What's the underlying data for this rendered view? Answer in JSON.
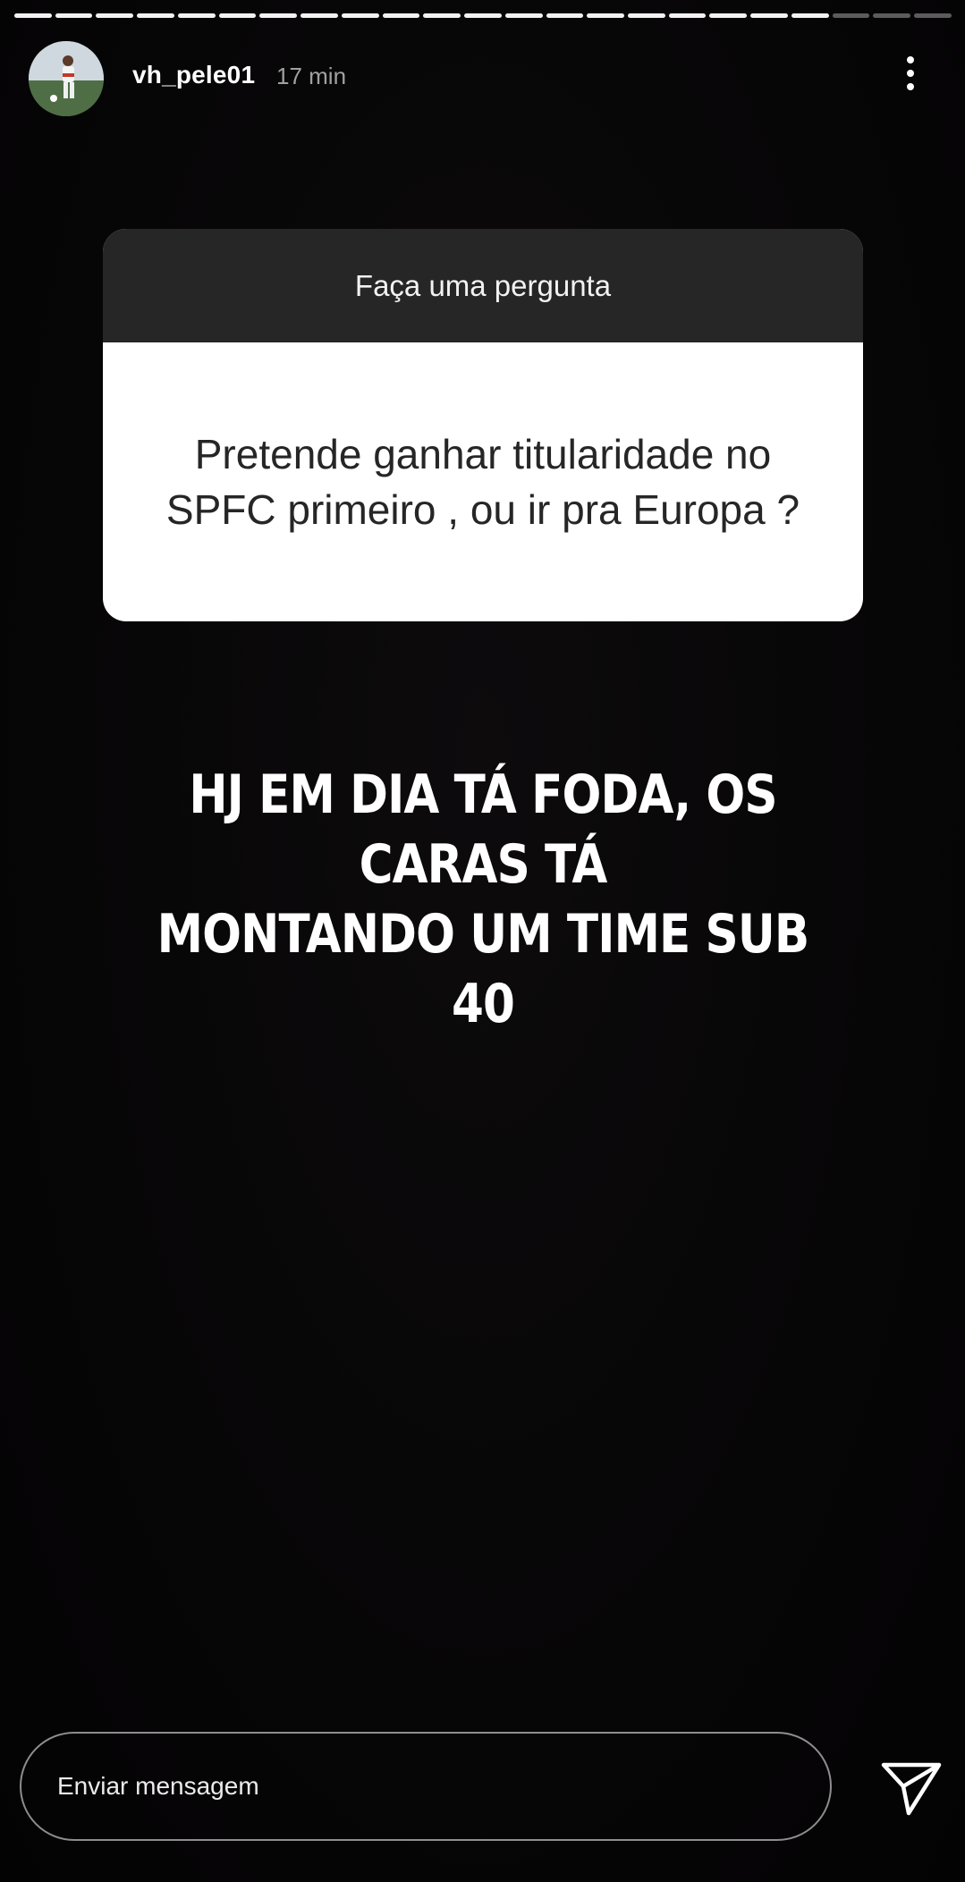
{
  "story": {
    "progress": {
      "total_segments": 23,
      "completed_segments": 20
    },
    "author": {
      "username": "vh_pele01",
      "posted_ago": "17 min",
      "avatar_icon": "profile-photo"
    },
    "more_icon": "more-vertical-icon",
    "question_sticker": {
      "header": "Faça uma pergunta",
      "question": "Pretende ganhar titularidade no SPFC primeiro , ou ir pra Europa ?"
    },
    "answer_text": {
      "line1": "HJ EM DIA TÁ FODA, OS CARAS TÁ",
      "line2": "MONTANDO UM TIME SUB 40"
    },
    "reply": {
      "placeholder": "Enviar mensagem",
      "value": "",
      "send_icon": "send-icon"
    }
  },
  "colors": {
    "background": "#060506",
    "sticker_header_bg": "#262626",
    "sticker_body_bg": "#ffffff",
    "sticker_text": "#262626",
    "text_primary": "#ffffff"
  }
}
